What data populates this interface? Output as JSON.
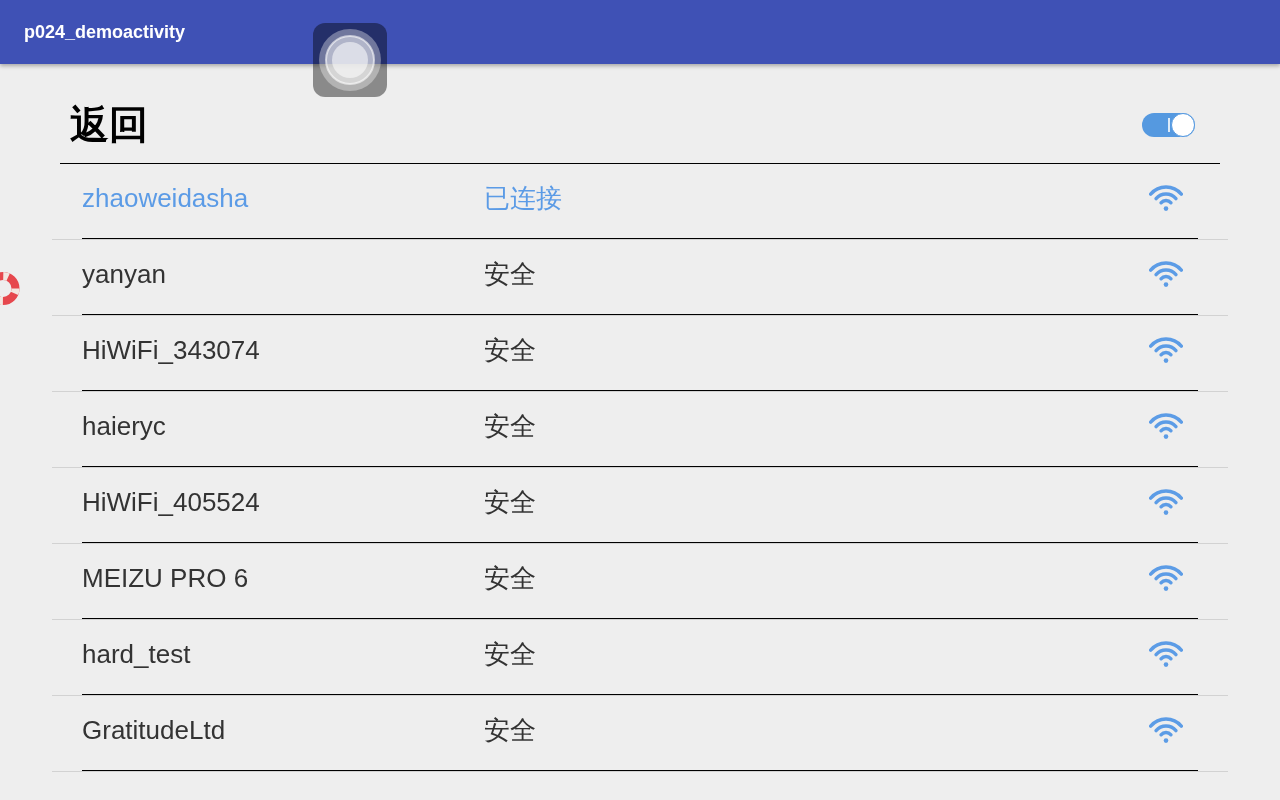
{
  "app_bar": {
    "title": "p024_demoactivity"
  },
  "header": {
    "title": "返回",
    "toggle": {
      "on": true
    }
  },
  "networks": [
    {
      "name": "zhaoweidasha",
      "status": "已连接",
      "connected": true
    },
    {
      "name": "yanyan",
      "status": "安全",
      "connected": false
    },
    {
      "name": "HiWiFi_343074",
      "status": "安全",
      "connected": false
    },
    {
      "name": "haieryc",
      "status": "安全",
      "connected": false
    },
    {
      "name": "HiWiFi_405524",
      "status": "安全",
      "connected": false
    },
    {
      "name": "MEIZU PRO 6",
      "status": "安全",
      "connected": false
    },
    {
      "name": "hard_test",
      "status": "安全",
      "connected": false
    },
    {
      "name": "GratitudeLtd",
      "status": "安全",
      "connected": false
    }
  ]
}
